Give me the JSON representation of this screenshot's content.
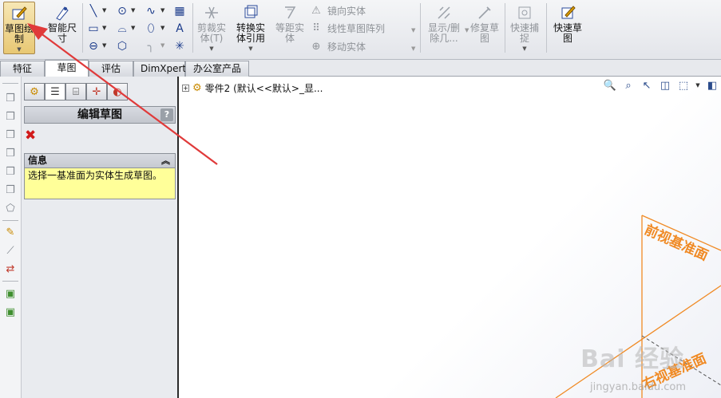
{
  "ribbon": {
    "sketch_button": "草图绘\n制",
    "smart_dim_button": "智能尺\n寸",
    "trim_button": "剪裁实\n体(T)",
    "convert_button": "转换实\n体引用",
    "offset_button": "等距实\n体",
    "mirror_label": "镜向实体",
    "pattern_label": "线性草图阵列",
    "move_label": "移动实体",
    "display_delete_button": "显示/删\n除几...",
    "repair_button": "修复草\n图",
    "quick_snap_button": "快速捕\n捉",
    "quick_sketch_button": "快速草\n图"
  },
  "tabs": [
    "特征",
    "草图",
    "评估",
    "DimXpert",
    "办公室产品"
  ],
  "active_tab": "草图",
  "property_manager": {
    "title": "编辑草图",
    "help": "?",
    "info_header": "信息",
    "info_text": "选择一基准面为实体生成草图。"
  },
  "tree": {
    "part_label": "零件2  (默认<<默认>_显..."
  },
  "planes": {
    "front": "前视基准面",
    "right": "右视基准面"
  },
  "watermark": {
    "brand": "Bai 经验",
    "url": "jingyan.baidu.com"
  },
  "colors": {
    "plane_orange": "#f08a24",
    "annotation_arrow": "#e03a3a",
    "info_background": "#ffff99"
  }
}
